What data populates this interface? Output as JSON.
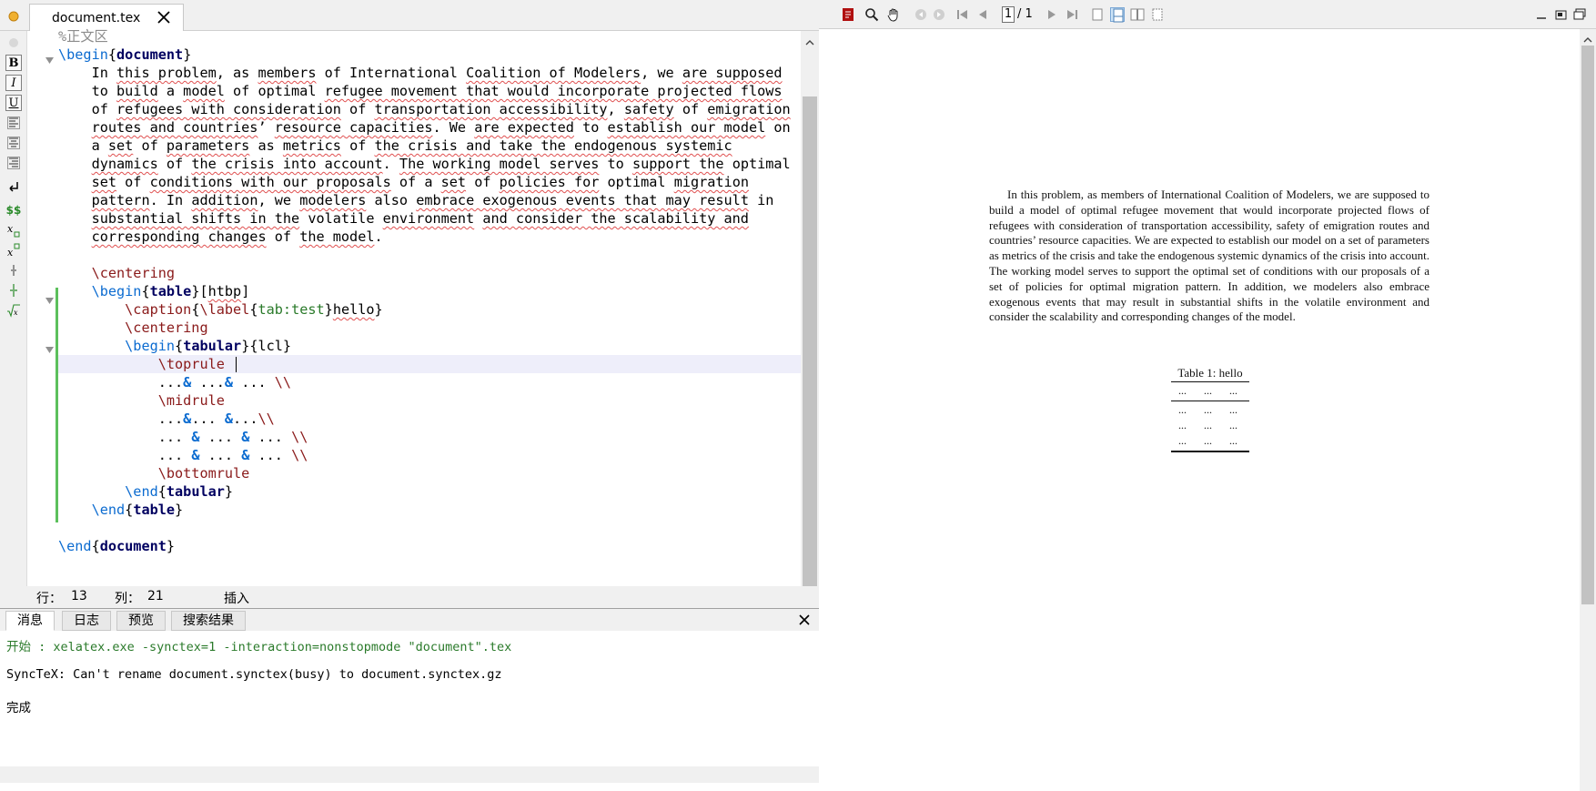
{
  "editor": {
    "tab_title": "document.tex",
    "lines": [
      {
        "segments": [
          {
            "t": "%正文区",
            "c": "cmt"
          }
        ]
      },
      {
        "segments": [
          {
            "t": "\\begin",
            "c": "kw"
          },
          {
            "t": "{",
            "c": ""
          },
          {
            "t": "document",
            "c": "env"
          },
          {
            "t": "}",
            "c": ""
          }
        ]
      },
      {
        "segments": [
          {
            "t": "    In ",
            "c": ""
          },
          {
            "t": "this problem",
            "c": "sq"
          },
          {
            "t": ", as ",
            "c": ""
          },
          {
            "t": "members",
            "c": "sq"
          },
          {
            "t": " of International ",
            "c": ""
          },
          {
            "t": "Coalition of Modelers",
            "c": "sq"
          },
          {
            "t": ", we ",
            "c": ""
          },
          {
            "t": "are supposed",
            "c": "sq"
          }
        ]
      },
      {
        "segments": [
          {
            "t": "    to ",
            "c": ""
          },
          {
            "t": "build",
            "c": "sq"
          },
          {
            "t": " a ",
            "c": ""
          },
          {
            "t": "model",
            "c": "sq"
          },
          {
            "t": " of optimal ",
            "c": ""
          },
          {
            "t": "refugee movement that would incorporate projected flows",
            "c": "sq"
          }
        ]
      },
      {
        "segments": [
          {
            "t": "    of ",
            "c": ""
          },
          {
            "t": "refugees with consideration",
            "c": "sq"
          },
          {
            "t": " of ",
            "c": ""
          },
          {
            "t": "transportation accessibility",
            "c": "sq"
          },
          {
            "t": ", ",
            "c": ""
          },
          {
            "t": "safety",
            "c": "sq"
          },
          {
            "t": " of ",
            "c": ""
          },
          {
            "t": "emigration",
            "c": "sq"
          }
        ]
      },
      {
        "segments": [
          {
            "t": "    ",
            "c": ""
          },
          {
            "t": "routes and countries",
            "c": "sq"
          },
          {
            "t": "’ ",
            "c": ""
          },
          {
            "t": "resource capacities",
            "c": "sq"
          },
          {
            "t": ". We ",
            "c": ""
          },
          {
            "t": "are expected",
            "c": "sq"
          },
          {
            "t": " to ",
            "c": ""
          },
          {
            "t": "establish our model",
            "c": "sq"
          },
          {
            "t": " on",
            "c": ""
          }
        ]
      },
      {
        "segments": [
          {
            "t": "    a ",
            "c": ""
          },
          {
            "t": "set",
            "c": "sq"
          },
          {
            "t": " of ",
            "c": ""
          },
          {
            "t": "parameters",
            "c": "sq"
          },
          {
            "t": " as ",
            "c": ""
          },
          {
            "t": "metrics",
            "c": "sq"
          },
          {
            "t": " of ",
            "c": ""
          },
          {
            "t": "the crisis and take the endogenous systemic",
            "c": "sq"
          }
        ]
      },
      {
        "segments": [
          {
            "t": "    ",
            "c": ""
          },
          {
            "t": "dynamics",
            "c": "sq"
          },
          {
            "t": " of ",
            "c": ""
          },
          {
            "t": "the crisis into account",
            "c": "sq"
          },
          {
            "t": ". ",
            "c": ""
          },
          {
            "t": "The working model serves",
            "c": "sq"
          },
          {
            "t": " to ",
            "c": ""
          },
          {
            "t": "support the",
            "c": "sq"
          },
          {
            "t": " optimal",
            "c": ""
          }
        ]
      },
      {
        "segments": [
          {
            "t": "    ",
            "c": ""
          },
          {
            "t": "set",
            "c": "sq"
          },
          {
            "t": " of ",
            "c": ""
          },
          {
            "t": "conditions with our proposals",
            "c": "sq"
          },
          {
            "t": " of a ",
            "c": ""
          },
          {
            "t": "set",
            "c": "sq"
          },
          {
            "t": " of ",
            "c": ""
          },
          {
            "t": "policies for",
            "c": "sq"
          },
          {
            "t": " optimal ",
            "c": ""
          },
          {
            "t": "migration",
            "c": "sq"
          }
        ]
      },
      {
        "segments": [
          {
            "t": "    ",
            "c": ""
          },
          {
            "t": "pattern",
            "c": "sq"
          },
          {
            "t": ". In ",
            "c": ""
          },
          {
            "t": "addition",
            "c": "sq"
          },
          {
            "t": ", we ",
            "c": ""
          },
          {
            "t": "modelers",
            "c": "sq"
          },
          {
            "t": " also ",
            "c": ""
          },
          {
            "t": "embrace exogenous events that may result",
            "c": "sq"
          },
          {
            "t": " in",
            "c": ""
          }
        ]
      },
      {
        "segments": [
          {
            "t": "    ",
            "c": ""
          },
          {
            "t": "substantial shifts in the",
            "c": "sq"
          },
          {
            "t": " volatile ",
            "c": ""
          },
          {
            "t": "environment",
            "c": "sq"
          },
          {
            "t": " ",
            "c": ""
          },
          {
            "t": "and consider the scalability and",
            "c": "sq"
          }
        ]
      },
      {
        "segments": [
          {
            "t": "    ",
            "c": ""
          },
          {
            "t": "corresponding changes",
            "c": "sq"
          },
          {
            "t": " of ",
            "c": ""
          },
          {
            "t": "the model",
            "c": "sq"
          },
          {
            "t": ".",
            "c": ""
          }
        ]
      },
      {
        "segments": []
      },
      {
        "segments": [
          {
            "t": "    ",
            "c": ""
          },
          {
            "t": "\\centering",
            "c": "cmd"
          }
        ]
      },
      {
        "segments": [
          {
            "t": "    ",
            "c": ""
          },
          {
            "t": "\\begin",
            "c": "kw"
          },
          {
            "t": "{",
            "c": ""
          },
          {
            "t": "table",
            "c": "env"
          },
          {
            "t": "}[",
            "c": ""
          },
          {
            "t": "htbp",
            "c": "sq"
          },
          {
            "t": "]",
            "c": ""
          }
        ]
      },
      {
        "segments": [
          {
            "t": "        ",
            "c": ""
          },
          {
            "t": "\\caption",
            "c": "cmd"
          },
          {
            "t": "{",
            "c": ""
          },
          {
            "t": "\\label",
            "c": "cmd"
          },
          {
            "t": "{",
            "c": ""
          },
          {
            "t": "tab:test",
            "c": "lbl"
          },
          {
            "t": "}",
            "c": ""
          },
          {
            "t": "hello",
            "c": "sq"
          },
          {
            "t": "}",
            "c": ""
          }
        ]
      },
      {
        "segments": [
          {
            "t": "        ",
            "c": ""
          },
          {
            "t": "\\centering",
            "c": "cmd"
          }
        ]
      },
      {
        "segments": [
          {
            "t": "        ",
            "c": ""
          },
          {
            "t": "\\begin",
            "c": "kw"
          },
          {
            "t": "{",
            "c": ""
          },
          {
            "t": "tabular",
            "c": "env"
          },
          {
            "t": "}{lcl}",
            "c": ""
          }
        ]
      },
      {
        "segments": [
          {
            "t": "            ",
            "c": ""
          },
          {
            "t": "\\toprule ",
            "c": "cmd"
          }
        ]
      },
      {
        "segments": [
          {
            "t": "            ...",
            "c": ""
          },
          {
            "t": "&",
            "c": "amp"
          },
          {
            "t": " ...",
            "c": ""
          },
          {
            "t": "&",
            "c": "amp"
          },
          {
            "t": " ... ",
            "c": ""
          },
          {
            "t": "\\\\",
            "c": "cmd"
          }
        ]
      },
      {
        "segments": [
          {
            "t": "            ",
            "c": ""
          },
          {
            "t": "\\midrule",
            "c": "cmd"
          }
        ]
      },
      {
        "segments": [
          {
            "t": "            ...",
            "c": ""
          },
          {
            "t": "&",
            "c": "amp"
          },
          {
            "t": "... ",
            "c": ""
          },
          {
            "t": "&",
            "c": "amp"
          },
          {
            "t": "...",
            "c": ""
          },
          {
            "t": "\\\\",
            "c": "cmd"
          }
        ]
      },
      {
        "segments": [
          {
            "t": "            ... ",
            "c": ""
          },
          {
            "t": "&",
            "c": "amp"
          },
          {
            "t": " ... ",
            "c": ""
          },
          {
            "t": "&",
            "c": "amp"
          },
          {
            "t": " ... ",
            "c": ""
          },
          {
            "t": "\\\\",
            "c": "cmd"
          }
        ]
      },
      {
        "segments": [
          {
            "t": "            ... ",
            "c": ""
          },
          {
            "t": "&",
            "c": "amp"
          },
          {
            "t": " ... ",
            "c": ""
          },
          {
            "t": "&",
            "c": "amp"
          },
          {
            "t": " ... ",
            "c": ""
          },
          {
            "t": "\\\\",
            "c": "cmd"
          }
        ]
      },
      {
        "segments": [
          {
            "t": "            ",
            "c": ""
          },
          {
            "t": "\\bottomrule",
            "c": "cmd"
          }
        ]
      },
      {
        "segments": [
          {
            "t": "        ",
            "c": ""
          },
          {
            "t": "\\end",
            "c": "kw"
          },
          {
            "t": "{",
            "c": ""
          },
          {
            "t": "tabular",
            "c": "env"
          },
          {
            "t": "}",
            "c": ""
          }
        ]
      },
      {
        "segments": [
          {
            "t": "    ",
            "c": ""
          },
          {
            "t": "\\end",
            "c": "kw"
          },
          {
            "t": "{",
            "c": ""
          },
          {
            "t": "table",
            "c": "env"
          },
          {
            "t": "}",
            "c": ""
          }
        ]
      },
      {
        "segments": []
      },
      {
        "segments": [
          {
            "t": "\\end",
            "c": "kw"
          },
          {
            "t": "{",
            "c": ""
          },
          {
            "t": "document",
            "c": "env"
          },
          {
            "t": "}",
            "c": ""
          }
        ]
      }
    ]
  },
  "status": {
    "row_label": "行：",
    "row_value": "13",
    "col_label": "列：",
    "col_value": "21",
    "mode": "插入"
  },
  "messages": {
    "tabs": [
      "消息",
      "日志",
      "预览",
      "搜索结果"
    ],
    "lines": [
      {
        "text": "开始 : xelatex.exe -synctex=1 -interaction=nonstopmode \"document\".tex",
        "color": "#2a7a2a"
      },
      {
        "text": "SyncTeX: Can't rename document.synctex(busy) to document.synctex.gz",
        "color": "#000000"
      },
      {
        "text": "完成",
        "color": "#000000"
      }
    ]
  },
  "pdf": {
    "page_current": "1",
    "page_total": "/ 1",
    "paragraph": "In this problem, as members of International Coalition of Modelers, we are supposed to build a model of optimal refugee movement that would incorporate projected flows of refugees with consideration of transportation accessibility, safety of emigration routes and countries’ resource capacities. We are expected to establish our model on a set of parameters as metrics of the crisis and take the endogenous systemic dynamics of the crisis into account. The working model serves to support the optimal set of conditions with our proposals of a set of policies for optimal migration pattern. In addition, we modelers also embrace exogenous events that may result in substantial shifts in the volatile environment and consider the scalability and corresponding changes of the model.",
    "table_caption": "Table 1: hello",
    "table_rows": [
      [
        "...",
        "...",
        "..."
      ],
      [
        "...",
        "...",
        "..."
      ],
      [
        "...",
        "...",
        "..."
      ],
      [
        "...",
        "...",
        "..."
      ]
    ]
  }
}
